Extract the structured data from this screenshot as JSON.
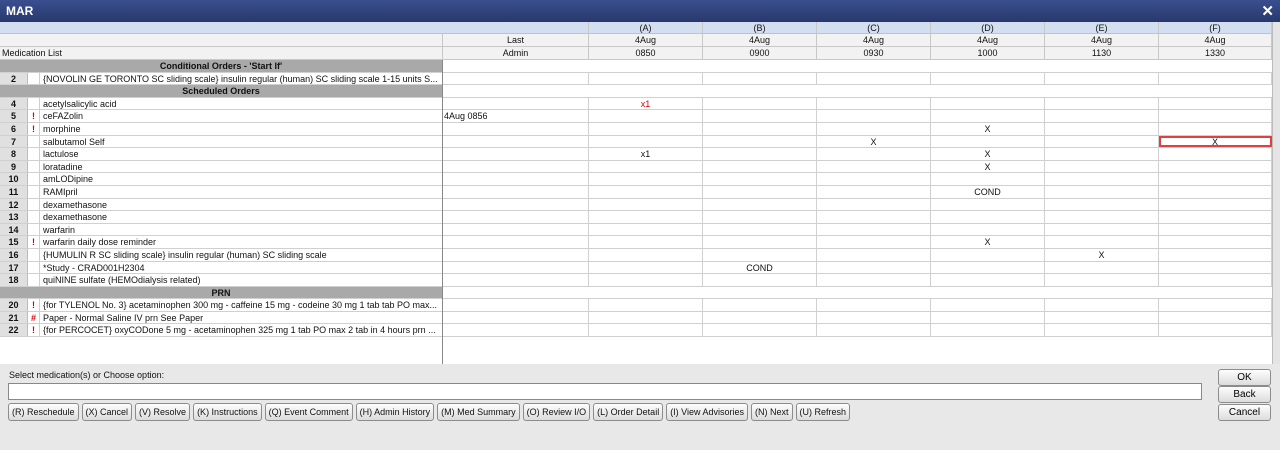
{
  "window": {
    "title": "MAR",
    "close_glyph": "✕"
  },
  "left_header": {
    "blank": "",
    "label": "Medication List"
  },
  "right_header": {
    "last_col": {
      "top": "",
      "mid": "Last",
      "bottom": "Admin"
    },
    "columns": [
      {
        "letter": "(A)",
        "date": "4Aug",
        "time": "0850"
      },
      {
        "letter": "(B)",
        "date": "4Aug",
        "time": "0900"
      },
      {
        "letter": "(C)",
        "date": "4Aug",
        "time": "0930"
      },
      {
        "letter": "(D)",
        "date": "4Aug",
        "time": "1000"
      },
      {
        "letter": "(E)",
        "date": "4Aug",
        "time": "1130"
      },
      {
        "letter": "(F)",
        "date": "4Aug",
        "time": "1330"
      }
    ]
  },
  "rows": [
    {
      "type": "section",
      "label": "Conditional Orders - 'Start If'"
    },
    {
      "type": "med",
      "num": "2",
      "flag": "",
      "name": "{NOVOLIN GE TORONTO SC sliding scale} insulin regular (human) SC sliding scale 1-15 units S...",
      "last": "",
      "cells": [
        "",
        "",
        "",
        "",
        "",
        ""
      ]
    },
    {
      "type": "section",
      "label": "Scheduled Orders"
    },
    {
      "type": "med",
      "num": "4",
      "flag": "",
      "name": "acetylsalicylic acid",
      "last": "",
      "cells": [
        "x1",
        "",
        "",
        "",
        "",
        ""
      ],
      "red": [
        0
      ]
    },
    {
      "type": "med",
      "num": "5",
      "flag": "!",
      "name": "ceFAZolin",
      "last": "4Aug 0856",
      "cells": [
        "",
        "",
        "",
        "",
        "",
        ""
      ]
    },
    {
      "type": "med",
      "num": "6",
      "flag": "!",
      "name": "morphine",
      "last": "",
      "cells": [
        "",
        "",
        "",
        "X",
        "",
        ""
      ]
    },
    {
      "type": "med",
      "num": "7",
      "flag": "",
      "name": "salbutamol  Self",
      "last": "",
      "cells": [
        "",
        "",
        "X",
        "",
        "",
        "X"
      ],
      "selected": [
        5
      ]
    },
    {
      "type": "med",
      "num": "8",
      "flag": "",
      "name": "lactulose",
      "last": "",
      "cells": [
        "x1",
        "",
        "",
        "X",
        "",
        ""
      ]
    },
    {
      "type": "med",
      "num": "9",
      "flag": "",
      "name": "loratadine",
      "last": "",
      "cells": [
        "",
        "",
        "",
        "X",
        "",
        ""
      ]
    },
    {
      "type": "med",
      "num": "10",
      "flag": "",
      "name": "amLODipine",
      "last": "",
      "cells": [
        "",
        "",
        "",
        "",
        "",
        ""
      ]
    },
    {
      "type": "med",
      "num": "11",
      "flag": "",
      "name": "RAMIpril",
      "last": "",
      "cells": [
        "",
        "",
        "",
        "COND",
        "",
        ""
      ]
    },
    {
      "type": "med",
      "num": "12",
      "flag": "",
      "name": "dexamethasone",
      "last": "",
      "cells": [
        "",
        "",
        "",
        "",
        "",
        ""
      ]
    },
    {
      "type": "med",
      "num": "13",
      "flag": "",
      "name": "dexamethasone",
      "last": "",
      "cells": [
        "",
        "",
        "",
        "",
        "",
        ""
      ]
    },
    {
      "type": "med",
      "num": "14",
      "flag": "",
      "name": "warfarin",
      "last": "",
      "cells": [
        "",
        "",
        "",
        "",
        "",
        ""
      ]
    },
    {
      "type": "med",
      "num": "15",
      "flag": "!",
      "name": "warfarin daily dose reminder",
      "last": "",
      "cells": [
        "",
        "",
        "",
        "X",
        "",
        ""
      ]
    },
    {
      "type": "med",
      "num": "16",
      "flag": "",
      "name": "{HUMULIN R SC sliding scale} insulin regular (human) SC sliding scale",
      "last": "",
      "cells": [
        "",
        "",
        "",
        "",
        "X",
        ""
      ]
    },
    {
      "type": "med",
      "num": "17",
      "flag": "",
      "name": "*Study - CRAD001H2304",
      "last": "",
      "cells": [
        "",
        "COND",
        "",
        "",
        "",
        ""
      ]
    },
    {
      "type": "med",
      "num": "18",
      "flag": "",
      "name": "quiNINE sulfate (HEMOdialysis related)",
      "last": "",
      "cells": [
        "",
        "",
        "",
        "",
        "",
        ""
      ]
    },
    {
      "type": "section",
      "label": "PRN"
    },
    {
      "type": "med",
      "num": "20",
      "flag": "!",
      "name": "{for TYLENOL No. 3} acetaminophen 300 mg - caffeine 15 mg - codeine 30 mg 1 tab tab PO max...",
      "last": "",
      "cells": [
        "",
        "",
        "",
        "",
        "",
        ""
      ]
    },
    {
      "type": "med",
      "num": "21",
      "flag": "#",
      "name": "Paper - Normal Saline IV prn See Paper",
      "last": "",
      "cells": [
        "",
        "",
        "",
        "",
        "",
        ""
      ]
    },
    {
      "type": "med",
      "num": "22",
      "flag": "!",
      "name": "{for PERCOCET} oxyCODone 5 mg - acetaminophen 325 mg  1 tab PO max 2 tab in 4 hours prn ...",
      "last": "",
      "cells": [
        "",
        "",
        "",
        "",
        "",
        ""
      ]
    }
  ],
  "command": {
    "prompt": "Select medication(s) or Choose option:",
    "value": "",
    "placeholder": ""
  },
  "buttons": [
    "(R) Reschedule",
    "(X) Cancel",
    "(V) Resolve",
    "(K) Instructions",
    "(Q) Event Comment",
    "(H) Admin History",
    "(M) Med Summary",
    "(O) Review I/O",
    "(L) Order Detail",
    "(I) View Advisories",
    "(N) Next",
    "(U) Refresh"
  ],
  "side_buttons": {
    "ok": "OK",
    "back": "Back",
    "cancel": "Cancel"
  }
}
